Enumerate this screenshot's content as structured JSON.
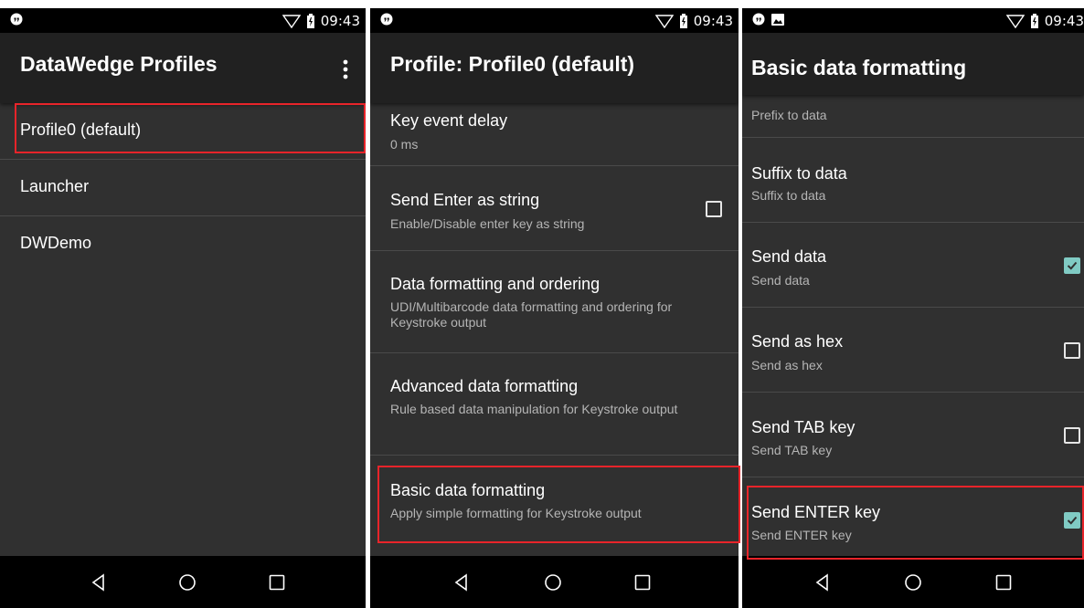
{
  "status": {
    "time_1": "09:43",
    "time_2": "09:43",
    "time_3": "09:43"
  },
  "screen1": {
    "title": "DataWedge Profiles",
    "items": [
      {
        "label": "Profile0 (default)"
      },
      {
        "label": "Launcher"
      },
      {
        "label": "DWDemo"
      }
    ]
  },
  "screen2": {
    "title": "Profile: Profile0 (default)",
    "items": [
      {
        "title": "Key event delay",
        "summary": "0 ms"
      },
      {
        "title": "Send Enter as string",
        "summary": "Enable/Disable enter key as string",
        "checked": false
      },
      {
        "title": "Data formatting and ordering",
        "summary": "UDI/Multibarcode data formatting and ordering for Keystroke output"
      },
      {
        "title": "Advanced data formatting",
        "summary": "Rule based data manipulation for Keystroke output"
      },
      {
        "title": "Basic data formatting",
        "summary": "Apply simple formatting for Keystroke output"
      }
    ]
  },
  "screen3": {
    "title": "Basic data formatting",
    "items": [
      {
        "title": "",
        "summary": "Prefix to data"
      },
      {
        "title": "Suffix to data",
        "summary": "Suffix to data"
      },
      {
        "title": "Send data",
        "summary": "Send data",
        "checked": true
      },
      {
        "title": "Send as hex",
        "summary": "Send as hex",
        "checked": false
      },
      {
        "title": "Send TAB key",
        "summary": "Send TAB key",
        "checked": false
      },
      {
        "title": "Send ENTER key",
        "summary": "Send ENTER key",
        "checked": true
      }
    ]
  },
  "colors": {
    "highlight": "#e8242a",
    "checkbox_checked": "#80cbc4",
    "appbar": "#212121",
    "background": "#303030"
  },
  "icons": [
    "notification-icon",
    "image-icon",
    "wifi-icon",
    "battery-icon",
    "overflow-menu-icon",
    "back-icon",
    "home-icon",
    "recents-icon",
    "checkbox-icon"
  ]
}
